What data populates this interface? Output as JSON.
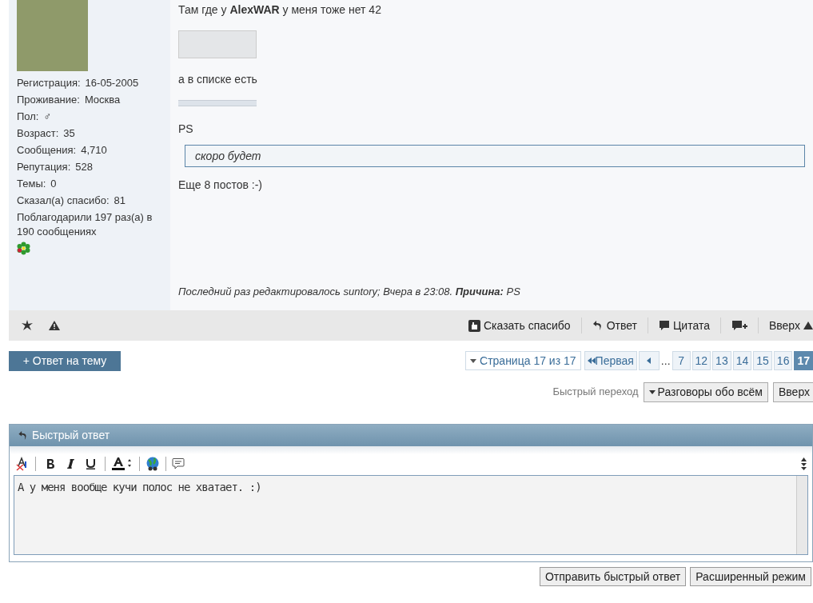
{
  "post": {
    "user_fields": [
      {
        "label": "Регистрация:",
        "value": "16-05-2005"
      },
      {
        "label": "Проживание:",
        "value": "Москва"
      },
      {
        "label": "Пол:",
        "value": "♂"
      },
      {
        "label": "Возраст:",
        "value": "35"
      },
      {
        "label": "Сообщения:",
        "value": "4,710"
      },
      {
        "label": "Репутация:",
        "value": "528"
      },
      {
        "label": "Темы:",
        "value": "0"
      },
      {
        "label": "Сказал(а) спасибо:",
        "value": "81"
      }
    ],
    "thanks": "Поблагодарили 197 раз(а) в 190 сообщениях",
    "body": [
      {
        "kind": "text",
        "text": "Там где у **AlexWAR** у меня тоже нет 42"
      },
      {
        "kind": "image"
      },
      {
        "kind": "text",
        "text": "а в списке есть"
      },
      {
        "kind": "strip"
      },
      {
        "kind": "text",
        "text": "PS"
      },
      {
        "kind": "quote",
        "text": "скоро будет"
      },
      {
        "kind": "text",
        "text": "Еще 8 постов :-)"
      }
    ],
    "edited": "Последний раз редактировалось suntory; Вчера в 23:08. **Причина:** PS",
    "actions": [
      {
        "kind": "thanks",
        "label": "Сказать спасибо"
      },
      {
        "kind": "reply",
        "label": "Ответ"
      },
      {
        "kind": "quote",
        "label": "Цитата"
      },
      {
        "kind": "multiquote"
      },
      {
        "kind": "top",
        "label": "Вверх"
      }
    ]
  },
  "reply_button": "+ Ответ на тему",
  "pagination": {
    "summary": "Страница 17 из 17",
    "first": "Первая",
    "ellipsis": "...",
    "pages": [
      {
        "label": "7",
        "selected": false
      },
      {
        "label": "12",
        "selected": false
      },
      {
        "label": "13",
        "selected": false
      },
      {
        "label": "14",
        "selected": false
      },
      {
        "label": "15",
        "selected": false
      },
      {
        "label": "16",
        "selected": false
      },
      {
        "label": "17",
        "selected": true
      }
    ]
  },
  "quick_nav": {
    "label": "Быстрый переход",
    "forum": "Разговоры обо всём",
    "top": "Вверх"
  },
  "quick_reply": {
    "title": "Быстрый ответ",
    "text": "А у меня вообще кучи полос не хватает. :)",
    "buttons": [
      "Отправить быстрый ответ",
      "Расширенный режим"
    ]
  }
}
